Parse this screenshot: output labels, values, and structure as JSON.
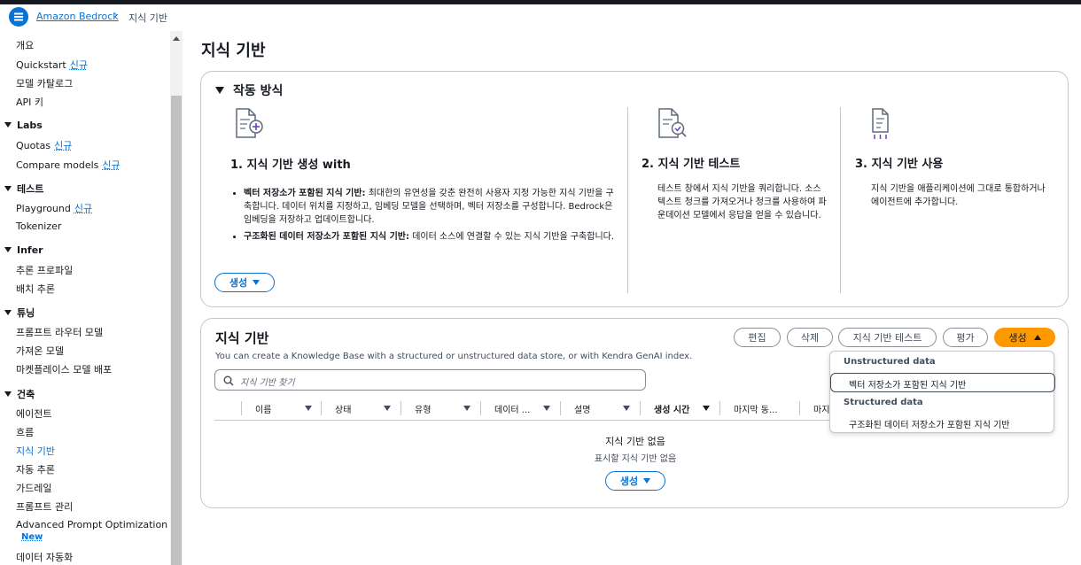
{
  "header": {
    "breadcrumb_link": "Amazon Bedrock",
    "breadcrumb_sep": "›",
    "breadcrumb_current": "지식 기반"
  },
  "sidebar": {
    "items_top": [
      {
        "label": "개요"
      },
      {
        "label": "Quickstart",
        "badge": "신규"
      },
      {
        "label": "모델 카탈로그"
      },
      {
        "label": "API 키"
      }
    ],
    "sections": [
      {
        "title": "Labs",
        "items": [
          {
            "label": "Quotas",
            "badge": "신규"
          },
          {
            "label": "Compare models",
            "badge": "신규"
          }
        ]
      },
      {
        "title": "테스트",
        "items": [
          {
            "label": "Playground",
            "badge": "신규"
          },
          {
            "label": "Tokenizer"
          }
        ]
      },
      {
        "title": "Infer",
        "items": [
          {
            "label": "추론 프로파일"
          },
          {
            "label": "배치 추론"
          }
        ]
      },
      {
        "title": "튜닝",
        "items": [
          {
            "label": "프롬프트 라우터 모델"
          },
          {
            "label": "가져온 모델"
          },
          {
            "label": "마켓플레이스 모델 배포"
          }
        ]
      },
      {
        "title": "건축",
        "items": [
          {
            "label": "에이전트"
          },
          {
            "label": "흐름"
          },
          {
            "label": "지식 기반"
          },
          {
            "label": "자동 추론"
          },
          {
            "label": "가드레일"
          },
          {
            "label": "프롬프트 관리"
          },
          {
            "label": "Advanced Prompt Optimization",
            "badge2": "New"
          },
          {
            "label": "데이터 자동화"
          }
        ]
      }
    ]
  },
  "page": {
    "title": "지식 기반"
  },
  "how": {
    "title": "작동 방식",
    "step1": {
      "title": "1. 지식 기반 생성 with",
      "b1_bold": "벡터 저장소가 포함된 지식 기반:",
      "b1_text": " 최대한의 유연성을 갖춘 완전히 사용자 지정 가능한 지식 기반을 구축합니다. 데이터 위치를 지정하고, 임베딩 모델을 선택하며, 벡터 저장소를 구성합니다. Bedrock은 임베딩을 저장하고 업데이트합니다.",
      "b2_bold": "구조화된 데이터 저장소가 포함된 지식 기반:",
      "b2_text": " 데이터 소스에 연결할 수 있는 지식 기반을 구축합니다.",
      "button": "생성"
    },
    "step2": {
      "title": "2. 지식 기반 테스트",
      "desc": "테스트 창에서 지식 기반을 쿼리합니다. 소스 텍스트 청크를 가져오거나 청크를 사용하여 파운데이션 모델에서 응답을 얻을 수 있습니다."
    },
    "step3": {
      "title": "3. 지식 기반 사용",
      "desc": "지식 기반을 애플리케이션에 그대로 통합하거나 에이전트에 추가합니다."
    }
  },
  "kb": {
    "title": "지식 기반",
    "subtitle": "You can create a Knowledge Base with a structured or unstructured data store, or with Kendra GenAI index.",
    "buttons": {
      "edit": "편집",
      "delete": "삭제",
      "test": "지식 기반 테스트",
      "eval": "평가",
      "create": "생성"
    },
    "search_placeholder": "지식 기반 찾기",
    "columns": [
      "이름",
      "상태",
      "유형",
      "데이터 ...",
      "설명",
      "생성 시간",
      "마지막 동...",
      "마지"
    ],
    "empty_title": "지식 기반 없음",
    "empty_sub": "표시할 지식 기반 없음",
    "empty_button": "생성"
  },
  "dropdown": {
    "group1": "Unstructured data",
    "item1": "벡터 저장소가 포함된 지식 기반",
    "group2": "Structured data",
    "item2": "구조화된 데이터 저장소가 포함된 지식 기반"
  },
  "colors": {
    "link": "#0972d3",
    "accent": "#ff9900",
    "text": "#16191f"
  }
}
